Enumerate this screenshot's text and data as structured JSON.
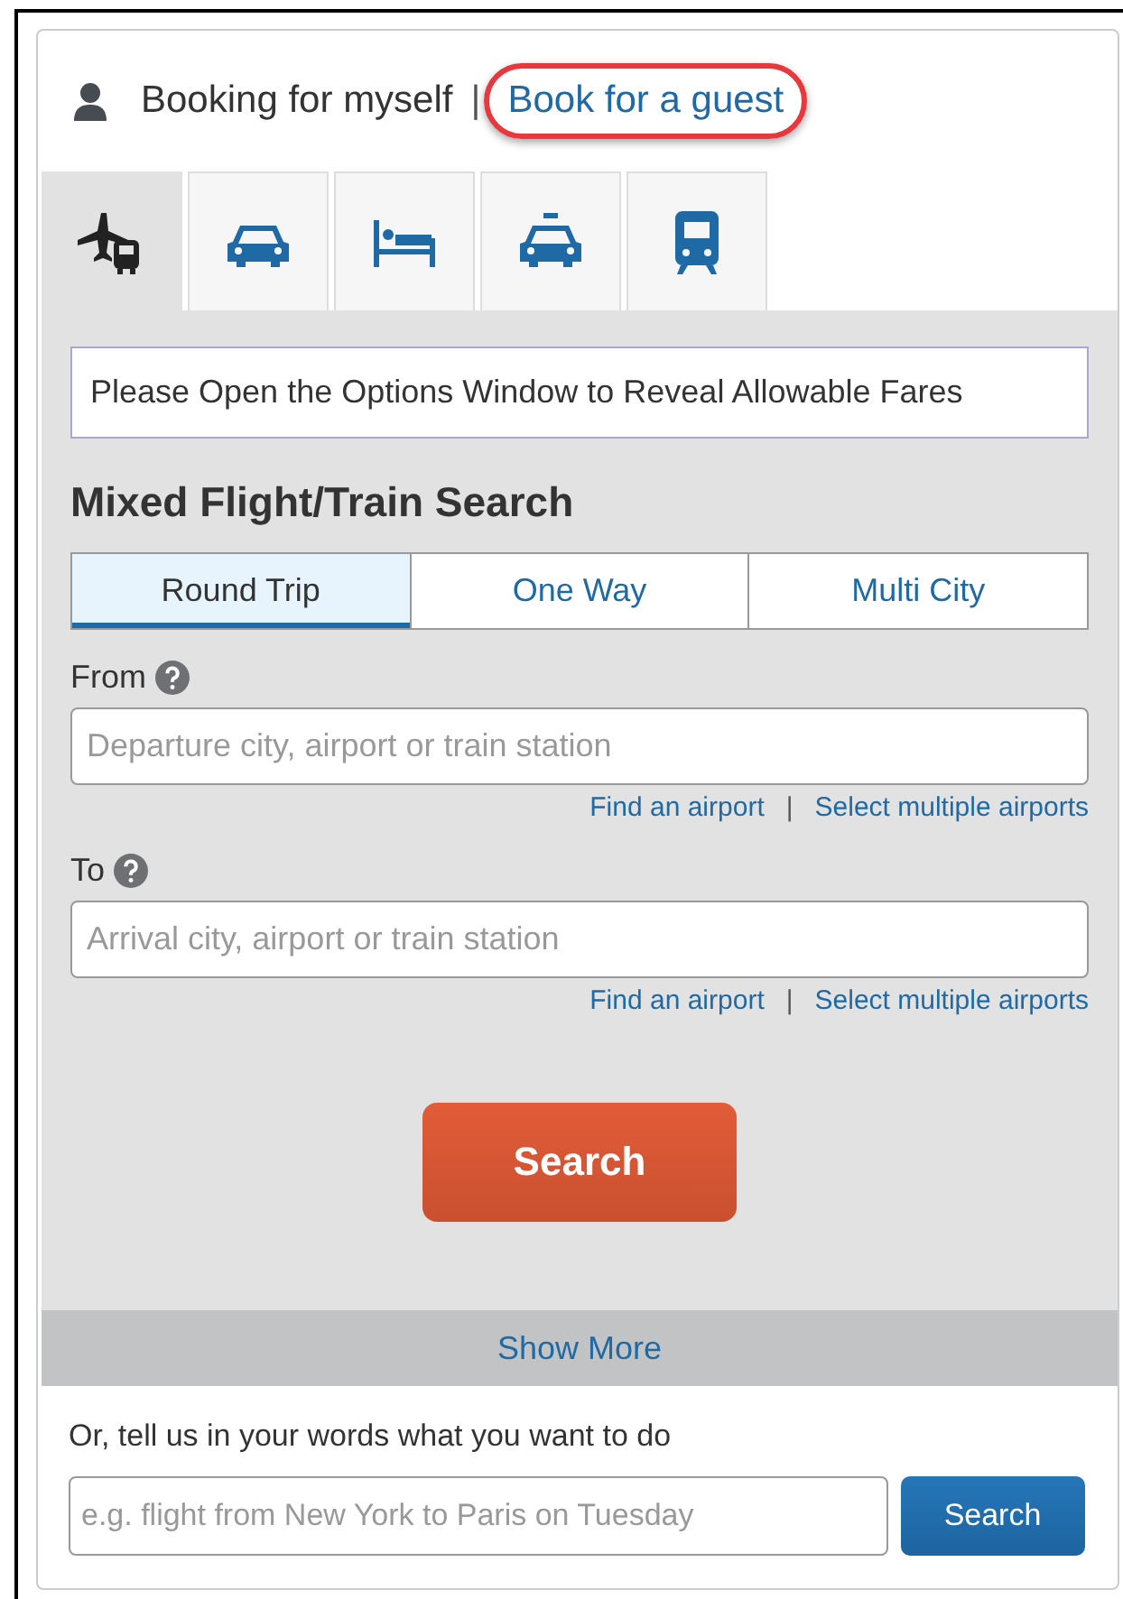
{
  "header": {
    "self_label": "Booking for myself",
    "separator": "|",
    "guest_link": {
      "label": "Book for a guest",
      "highlighted": true
    }
  },
  "tabs": [
    {
      "kind": "flight-train",
      "selected": true
    },
    {
      "kind": "car",
      "selected": false
    },
    {
      "kind": "hotel",
      "selected": false
    },
    {
      "kind": "taxi",
      "selected": false
    },
    {
      "kind": "train",
      "selected": false
    }
  ],
  "notice": "Please Open the Options Window to Reveal Allowable Fares",
  "search_title": "Mixed Flight/Train Search",
  "trip_types": [
    {
      "label": "Round Trip",
      "selected": true
    },
    {
      "label": "One Way",
      "selected": false
    },
    {
      "label": "Multi City",
      "selected": false
    }
  ],
  "fields": [
    {
      "label": "From",
      "placeholder": "Departure city, airport or train station",
      "links": [
        "Find an airport",
        "Select multiple airports"
      ],
      "separator": "|"
    },
    {
      "label": "To",
      "placeholder": "Arrival city, airport or train station",
      "links": [
        "Find an airport",
        "Select multiple airports"
      ],
      "separator": "|"
    }
  ],
  "search_button": "Search",
  "show_more": "Show More",
  "natural": {
    "prompt": "Or, tell us in your words what you want to do",
    "placeholder": "e.g. flight from New York to Paris on Tuesday",
    "button": "Search"
  }
}
